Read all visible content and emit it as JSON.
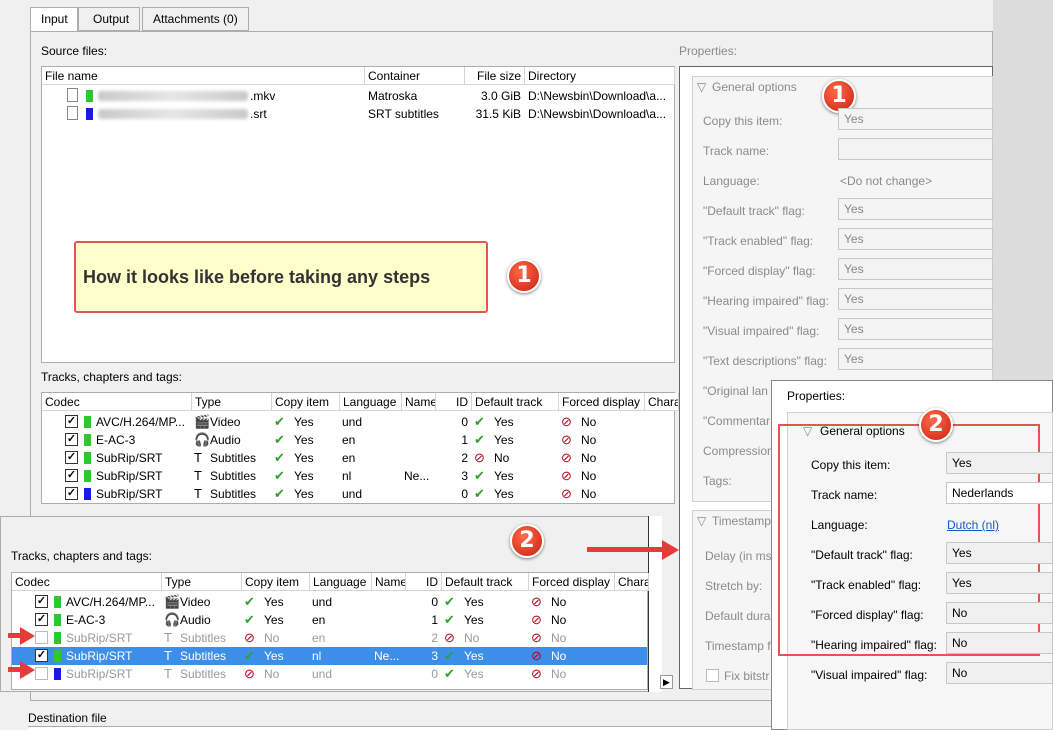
{
  "tabs": [
    "Input",
    "Output",
    "Attachments (0)"
  ],
  "source_files": {
    "label": "Source files:",
    "headers": [
      "File name",
      "Container",
      "File size",
      "Directory"
    ],
    "rows": [
      {
        "name_suffix": ".mkv",
        "container": "Matroska",
        "size": "3.0 GiB",
        "dir": "D:\\Newsbin\\Download\\a...",
        "color": "#2ec82e"
      },
      {
        "name_suffix": ".srt",
        "container": "SRT subtitles",
        "size": "31.5 KiB",
        "dir": "D:\\Newsbin\\Download\\a...",
        "color": "#1a1ae6"
      }
    ]
  },
  "callout": "How it looks like before taking any steps",
  "badges": [
    "1",
    "2"
  ],
  "tracks_label": "Tracks, chapters and tags:",
  "track_headers": [
    "Codec",
    "Type",
    "Copy item",
    "Language",
    "Name",
    "ID",
    "Default track",
    "Forced display",
    "Chara"
  ],
  "tracks1": [
    {
      "codec": "AVC/H.264/MP...",
      "type": "Video",
      "copy": "Yes",
      "lang": "und",
      "name": "",
      "id": "0",
      "def": "Yes",
      "forced": "No",
      "color": "#2ec82e",
      "checked": true,
      "def_yes": true,
      "copy_yes": true
    },
    {
      "codec": "E-AC-3",
      "type": "Audio",
      "copy": "Yes",
      "lang": "en",
      "name": "",
      "id": "1",
      "def": "Yes",
      "forced": "No",
      "color": "#2ec82e",
      "checked": true,
      "def_yes": true,
      "copy_yes": true
    },
    {
      "codec": "SubRip/SRT",
      "type": "Subtitles",
      "copy": "Yes",
      "lang": "en",
      "name": "",
      "id": "2",
      "def": "No",
      "forced": "No",
      "color": "#2ec82e",
      "checked": true,
      "def_yes": false,
      "copy_yes": true
    },
    {
      "codec": "SubRip/SRT",
      "type": "Subtitles",
      "copy": "Yes",
      "lang": "nl",
      "name": "Ne...",
      "id": "3",
      "def": "Yes",
      "forced": "No",
      "color": "#2ec82e",
      "checked": true,
      "def_yes": true,
      "copy_yes": true
    },
    {
      "codec": "SubRip/SRT",
      "type": "Subtitles",
      "copy": "Yes",
      "lang": "und",
      "name": "",
      "id": "0",
      "def": "Yes",
      "forced": "No",
      "color": "#1a1ae6",
      "checked": true,
      "def_yes": true,
      "copy_yes": true
    }
  ],
  "tracks2": [
    {
      "codec": "AVC/H.264/MP...",
      "type": "Video",
      "copy": "Yes",
      "lang": "und",
      "name": "",
      "id": "0",
      "def": "Yes",
      "forced": "No",
      "color": "#2ec82e",
      "checked": true,
      "def_yes": true,
      "copy_yes": true
    },
    {
      "codec": "E-AC-3",
      "type": "Audio",
      "copy": "Yes",
      "lang": "en",
      "name": "",
      "id": "1",
      "def": "Yes",
      "forced": "No",
      "color": "#2ec82e",
      "checked": true,
      "def_yes": true,
      "copy_yes": true
    },
    {
      "codec": "SubRip/SRT",
      "type": "Subtitles",
      "copy": "No",
      "lang": "en",
      "name": "",
      "id": "2",
      "def": "No",
      "forced": "No",
      "color": "#2ec82e",
      "checked": false,
      "def_yes": false,
      "copy_yes": false
    },
    {
      "codec": "SubRip/SRT",
      "type": "Subtitles",
      "copy": "Yes",
      "lang": "nl",
      "name": "Ne...",
      "id": "3",
      "def": "Yes",
      "forced": "No",
      "color": "#2ec82e",
      "checked": true,
      "def_yes": true,
      "copy_yes": true
    },
    {
      "codec": "SubRip/SRT",
      "type": "Subtitles",
      "copy": "No",
      "lang": "und",
      "name": "",
      "id": "0",
      "def": "Yes",
      "forced": "No",
      "color": "#1a1ae6",
      "checked": false,
      "def_yes": true,
      "copy_yes": false
    }
  ],
  "properties_label": "Properties:",
  "general_options": "General options",
  "props1": [
    {
      "label": "Copy this item:",
      "value": "Yes"
    },
    {
      "label": "Track name:",
      "value": ""
    },
    {
      "label": "Language:",
      "value": "<Do not change>"
    },
    {
      "label": "\"Default track\" flag:",
      "value": "Yes"
    },
    {
      "label": "\"Track enabled\" flag:",
      "value": "Yes"
    },
    {
      "label": "\"Forced display\" flag:",
      "value": "Yes"
    },
    {
      "label": "\"Hearing impaired\" flag:",
      "value": "Yes"
    },
    {
      "label": "\"Visual impaired\" flag:",
      "value": "Yes"
    },
    {
      "label": "\"Text descriptions\" flag:",
      "value": "Yes"
    },
    {
      "label": "\"Original lan",
      "value": ""
    },
    {
      "label": "\"Commentar",
      "value": ""
    },
    {
      "label": "Compression",
      "value": ""
    },
    {
      "label": "Tags:",
      "value": ""
    }
  ],
  "timestamps_label": "Timestamp",
  "ts_rows": [
    "Delay (in ms",
    "Stretch by:",
    "Default dura",
    "Timestamp f",
    "Fix bitstr"
  ],
  "props2": [
    {
      "label": "Copy this item:",
      "value": "Yes"
    },
    {
      "label": "Track name:",
      "value": "Nederlands"
    },
    {
      "label": "Language:",
      "value": "Dutch (nl)"
    },
    {
      "label": "\"Default track\" flag:",
      "value": "Yes"
    },
    {
      "label": "\"Track enabled\" flag:",
      "value": "Yes"
    },
    {
      "label": "\"Forced display\" flag:",
      "value": "No"
    },
    {
      "label": "\"Hearing impaired\" flag:",
      "value": "No"
    },
    {
      "label": "\"Visual impaired\" flag:",
      "value": "No"
    }
  ],
  "destination_label": "Destination file"
}
